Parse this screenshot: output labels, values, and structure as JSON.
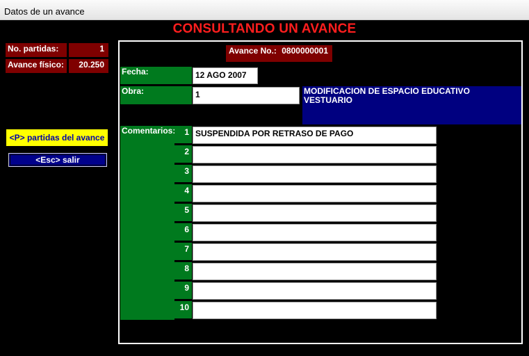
{
  "window": {
    "title": "Datos de un avance"
  },
  "header": {
    "title": "CONSULTANDO UN AVANCE"
  },
  "stats": {
    "partidas_label": "No. partidas:",
    "partidas_value": "1",
    "fisico_label": "Avance físico:",
    "fisico_value": "20.250"
  },
  "actions": {
    "partidas_button": "<P> partidas del avance",
    "salir_button": "<Esc> salir"
  },
  "form": {
    "avance_label": "Avance No.:",
    "avance_value": "0800000001",
    "fecha_label": "Fecha:",
    "fecha_value": "12 AGO 2007",
    "obra_label": "Obra:",
    "obra_value": "1",
    "obra_desc_line1": "MODIFICACION  DE ESPACIO EDUCATIVO",
    "obra_desc_line2": "VESTUARIO",
    "comentarios_label": "Comentarios:",
    "comentarios": [
      {
        "n": "1",
        "text": "SUSPENDIDA POR RETRASO DE PAGO"
      },
      {
        "n": "2",
        "text": ""
      },
      {
        "n": "3",
        "text": ""
      },
      {
        "n": "4",
        "text": ""
      },
      {
        "n": "5",
        "text": ""
      },
      {
        "n": "6",
        "text": ""
      },
      {
        "n": "7",
        "text": ""
      },
      {
        "n": "8",
        "text": ""
      },
      {
        "n": "9",
        "text": ""
      },
      {
        "n": "10",
        "text": ""
      }
    ]
  },
  "colors": {
    "title_red": "#ff1e1e",
    "label_green": "#007a1e",
    "label_darkred": "#7f0000",
    "desc_navy": "#000080",
    "button_yellow": "#ffff00"
  }
}
